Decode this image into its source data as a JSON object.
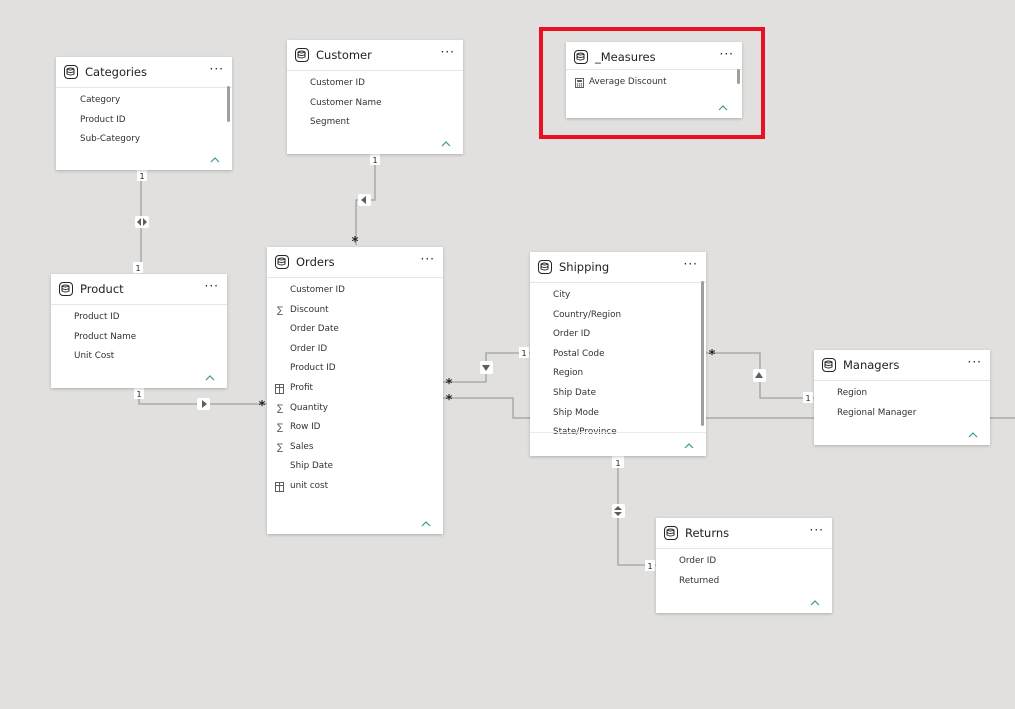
{
  "tables": {
    "categories": {
      "title": "Categories",
      "fields": [
        "Category",
        "Product ID",
        "Sub-Category"
      ]
    },
    "customer": {
      "title": "Customer",
      "fields": [
        "Customer ID",
        "Customer Name",
        "Segment"
      ]
    },
    "measures": {
      "title": "_Measures",
      "fields": [
        "Average Discount"
      ]
    },
    "product": {
      "title": "Product",
      "fields": [
        "Product ID",
        "Product Name",
        "Unit Cost"
      ]
    },
    "orders": {
      "title": "Orders",
      "fields": [
        "Customer ID",
        "Discount",
        "Order Date",
        "Order ID",
        "Product ID",
        "Profit",
        "Quantity",
        "Row ID",
        "Sales",
        "Ship Date",
        "unit cost"
      ]
    },
    "shipping": {
      "title": "Shipping",
      "fields": [
        "City",
        "Country/Region",
        "Order ID",
        "Postal Code",
        "Region",
        "Ship Date",
        "Ship Mode",
        "State/Province"
      ]
    },
    "managers": {
      "title": "Managers",
      "fields": [
        "Region",
        "Regional Manager"
      ]
    },
    "returns": {
      "title": "Returns",
      "fields": [
        "Order ID",
        "Returned"
      ]
    }
  },
  "ui": {
    "more_label": "···"
  },
  "relationships": {
    "one": "1",
    "many": "*"
  },
  "colors": {
    "canvas": "#e1e0de",
    "card": "#ffffff",
    "line": "#a19f9d",
    "collapse": "#3b9b8f",
    "highlight": "#e81123"
  }
}
